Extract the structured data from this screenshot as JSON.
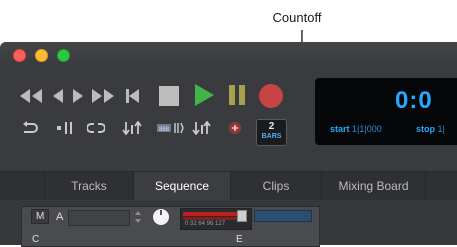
{
  "callout": {
    "label": "Countoff"
  },
  "window": {
    "controls": [
      "close",
      "minimize",
      "maximize"
    ]
  },
  "transport": {
    "buttons": [
      {
        "name": "rewind",
        "icon": "rewind-icon"
      },
      {
        "name": "back",
        "icon": "step-back-icon"
      },
      {
        "name": "forward",
        "icon": "step-forward-icon"
      },
      {
        "name": "fast-forward",
        "icon": "fast-forward-icon"
      },
      {
        "name": "go-to-start",
        "icon": "go-to-start-icon"
      },
      {
        "name": "stop",
        "icon": "stop-icon"
      },
      {
        "name": "play",
        "icon": "play-icon"
      },
      {
        "name": "pause",
        "icon": "pause-icon"
      },
      {
        "name": "record",
        "icon": "record-icon"
      }
    ],
    "tools": [
      {
        "name": "loop",
        "icon": "loop-return-icon"
      },
      {
        "name": "metronome",
        "icon": "metronome-icon"
      },
      {
        "name": "cycle",
        "icon": "cycle-icon"
      },
      {
        "name": "punch-in",
        "icon": "punch-in-icon"
      },
      {
        "name": "punch-range",
        "icon": "punch-range-icon"
      },
      {
        "name": "punch-out",
        "icon": "punch-out-icon"
      },
      {
        "name": "add",
        "icon": "add-circle-icon"
      }
    ],
    "countoff": {
      "value": "2",
      "unit": "BARS"
    }
  },
  "counter": {
    "time": "0:0",
    "start_label": "start",
    "start_value": "1|1|000",
    "stop_label": "stop",
    "stop_value": "1|"
  },
  "tabs": [
    {
      "label": "Tracks",
      "active": false
    },
    {
      "label": "Sequence",
      "active": true
    },
    {
      "label": "Clips",
      "active": false
    },
    {
      "label": "Mixing Board",
      "active": false
    }
  ],
  "track": {
    "mode": "M",
    "name": "A",
    "row2_left": "C",
    "row2_right": "E",
    "meter_scale": "0 32 64 96 127"
  },
  "colors": {
    "play": "#42b549",
    "record": "#c64444",
    "counter_text": "#27a7ff",
    "pause": "#a6a24c"
  }
}
